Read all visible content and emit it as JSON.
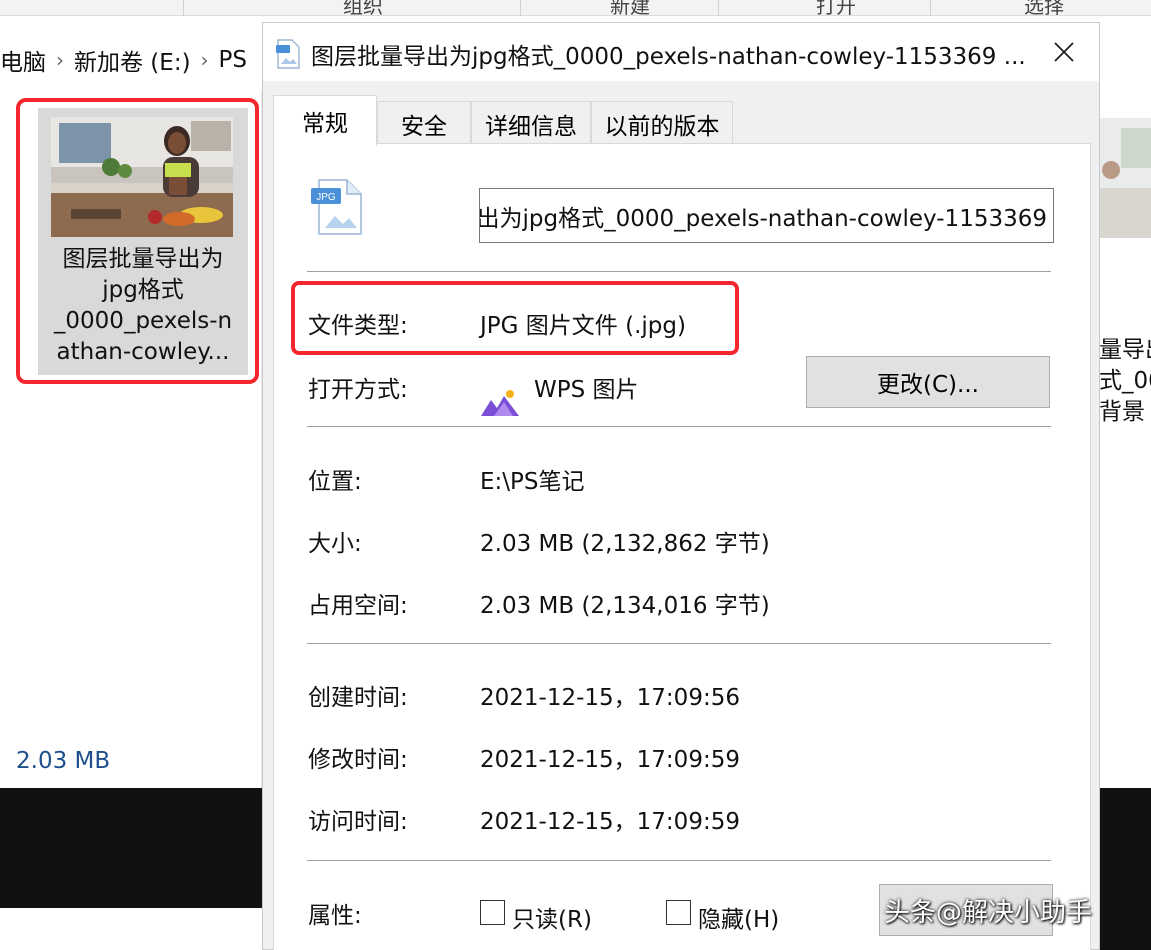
{
  "ribbon": {
    "items": [
      "组织",
      "新建",
      "打开",
      "选择"
    ]
  },
  "address_bar": {
    "segments": [
      "电脑",
      "新加卷 (E:)",
      "PS"
    ]
  },
  "explorer": {
    "file_tile_name": "图层批量导出为jpg格式_0000_pexels-nathan-cowley...",
    "file_tile_lines": [
      "图层批量导出为",
      "jpg格式",
      "_0000_pexels-n",
      "athan-cowley..."
    ],
    "status_size": "2.03 MB",
    "right_partial_lines": [
      "量导出",
      "式_00",
      "背景"
    ]
  },
  "dialog": {
    "title": "图层批量导出为jpg格式_0000_pexels-nathan-cowley-1153369 ...",
    "tabs": [
      "常规",
      "安全",
      "详细信息",
      "以前的版本"
    ],
    "active_tab": "常规",
    "file_name_value": "出为jpg格式_0000_pexels-nathan-cowley-1153369",
    "icon_badge": "JPG",
    "file_type_label": "文件类型:",
    "file_type_value": "JPG 图片文件 (.jpg)",
    "open_with_label": "打开方式:",
    "open_with_value": "WPS 图片",
    "change_button": "更改(C)...",
    "location_label": "位置:",
    "location_value": "E:\\PS笔记",
    "size_label": "大小:",
    "size_value": "2.03 MB (2,132,862 字节)",
    "disk_size_label": "占用空间:",
    "disk_size_value": "2.03 MB (2,134,016 字节)",
    "created_label": "创建时间:",
    "created_value": "2021-12-15，17:09:56",
    "modified_label": "修改时间:",
    "modified_value": "2021-12-15，17:09:59",
    "accessed_label": "访问时间:",
    "accessed_value": "2021-12-15，17:09:59",
    "attributes_label": "属性:",
    "readonly_label": "只读(R)",
    "hidden_label": "隐藏(H)",
    "readonly_checked": false,
    "hidden_checked": false
  },
  "watermark": "头条@解决小助手",
  "colors": {
    "highlight_red": "#f2262c",
    "dialog_bg": "#f0f0f0",
    "button_bg": "#e1e1e1",
    "status_blue": "#1e4f8d"
  }
}
